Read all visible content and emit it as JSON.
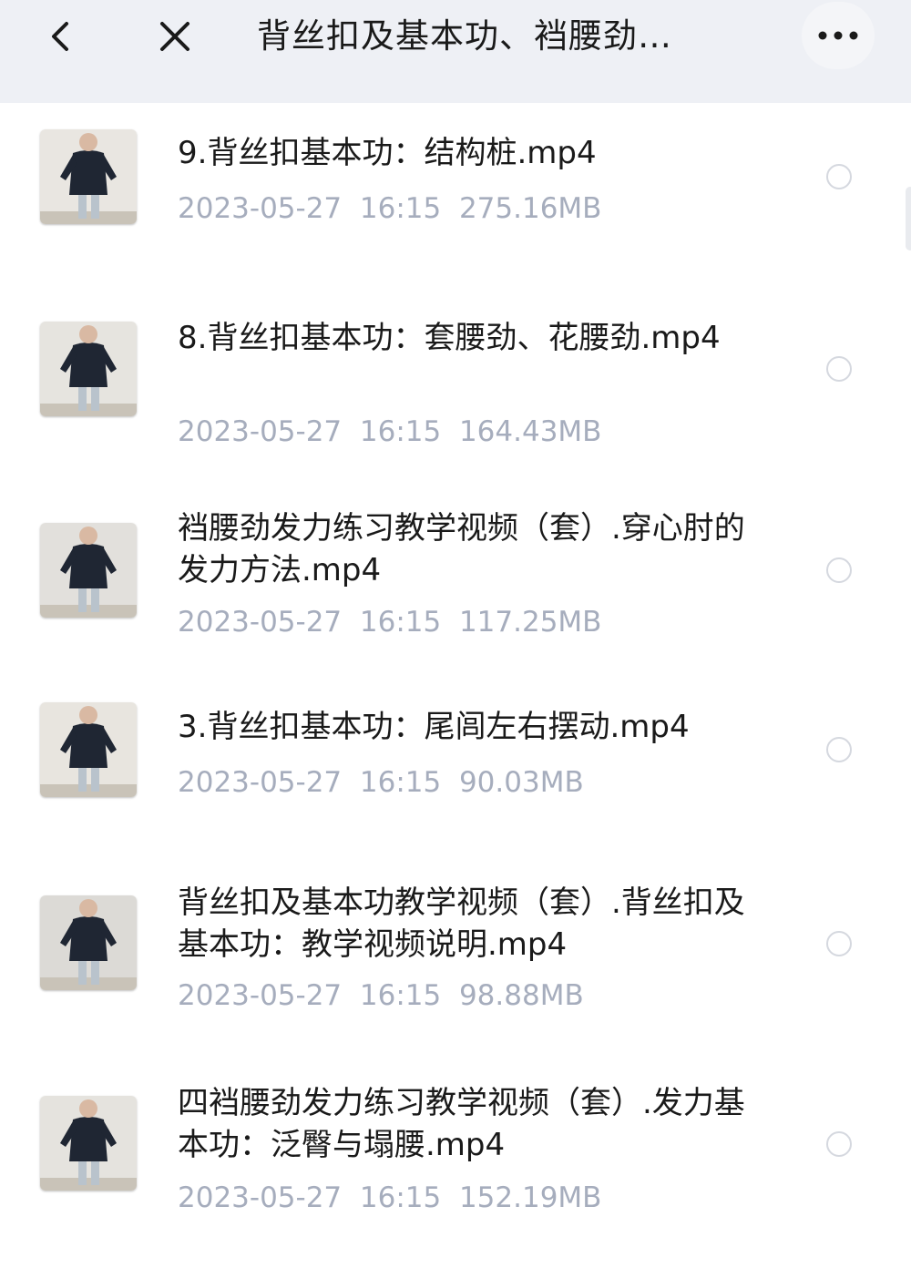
{
  "header": {
    "back_icon": "chevron-left-icon",
    "close_icon": "close-icon",
    "title": "背丝扣及基本功、裆腰劲…",
    "more_icon": "more-dots-icon"
  },
  "files": [
    {
      "name": "9.背丝扣基本功：结构桩.mp4",
      "date": "2023-05-27",
      "time": "16:15",
      "size": "275.16MB"
    },
    {
      "name": "8.背丝扣基本功：套腰劲、花腰劲.mp4",
      "date": "2023-05-27",
      "time": "16:15",
      "size": "164.43MB"
    },
    {
      "name": "裆腰劲发力练习教学视频（套）.穿心肘的发力方法.mp4",
      "date": "2023-05-27",
      "time": "16:15",
      "size": "117.25MB"
    },
    {
      "name": "3.背丝扣基本功：尾闾左右摆动.mp4",
      "date": "2023-05-27",
      "time": "16:15",
      "size": "90.03MB"
    },
    {
      "name": "背丝扣及基本功教学视频（套）.背丝扣及基本功：教学视频说明.mp4",
      "date": "2023-05-27",
      "time": "16:15",
      "size": "98.88MB"
    },
    {
      "name": "四裆腰劲发力练习教学视频（套）.发力基本功：泛臀与塌腰.mp4",
      "date": "2023-05-27",
      "time": "16:15",
      "size": "152.19MB"
    }
  ]
}
